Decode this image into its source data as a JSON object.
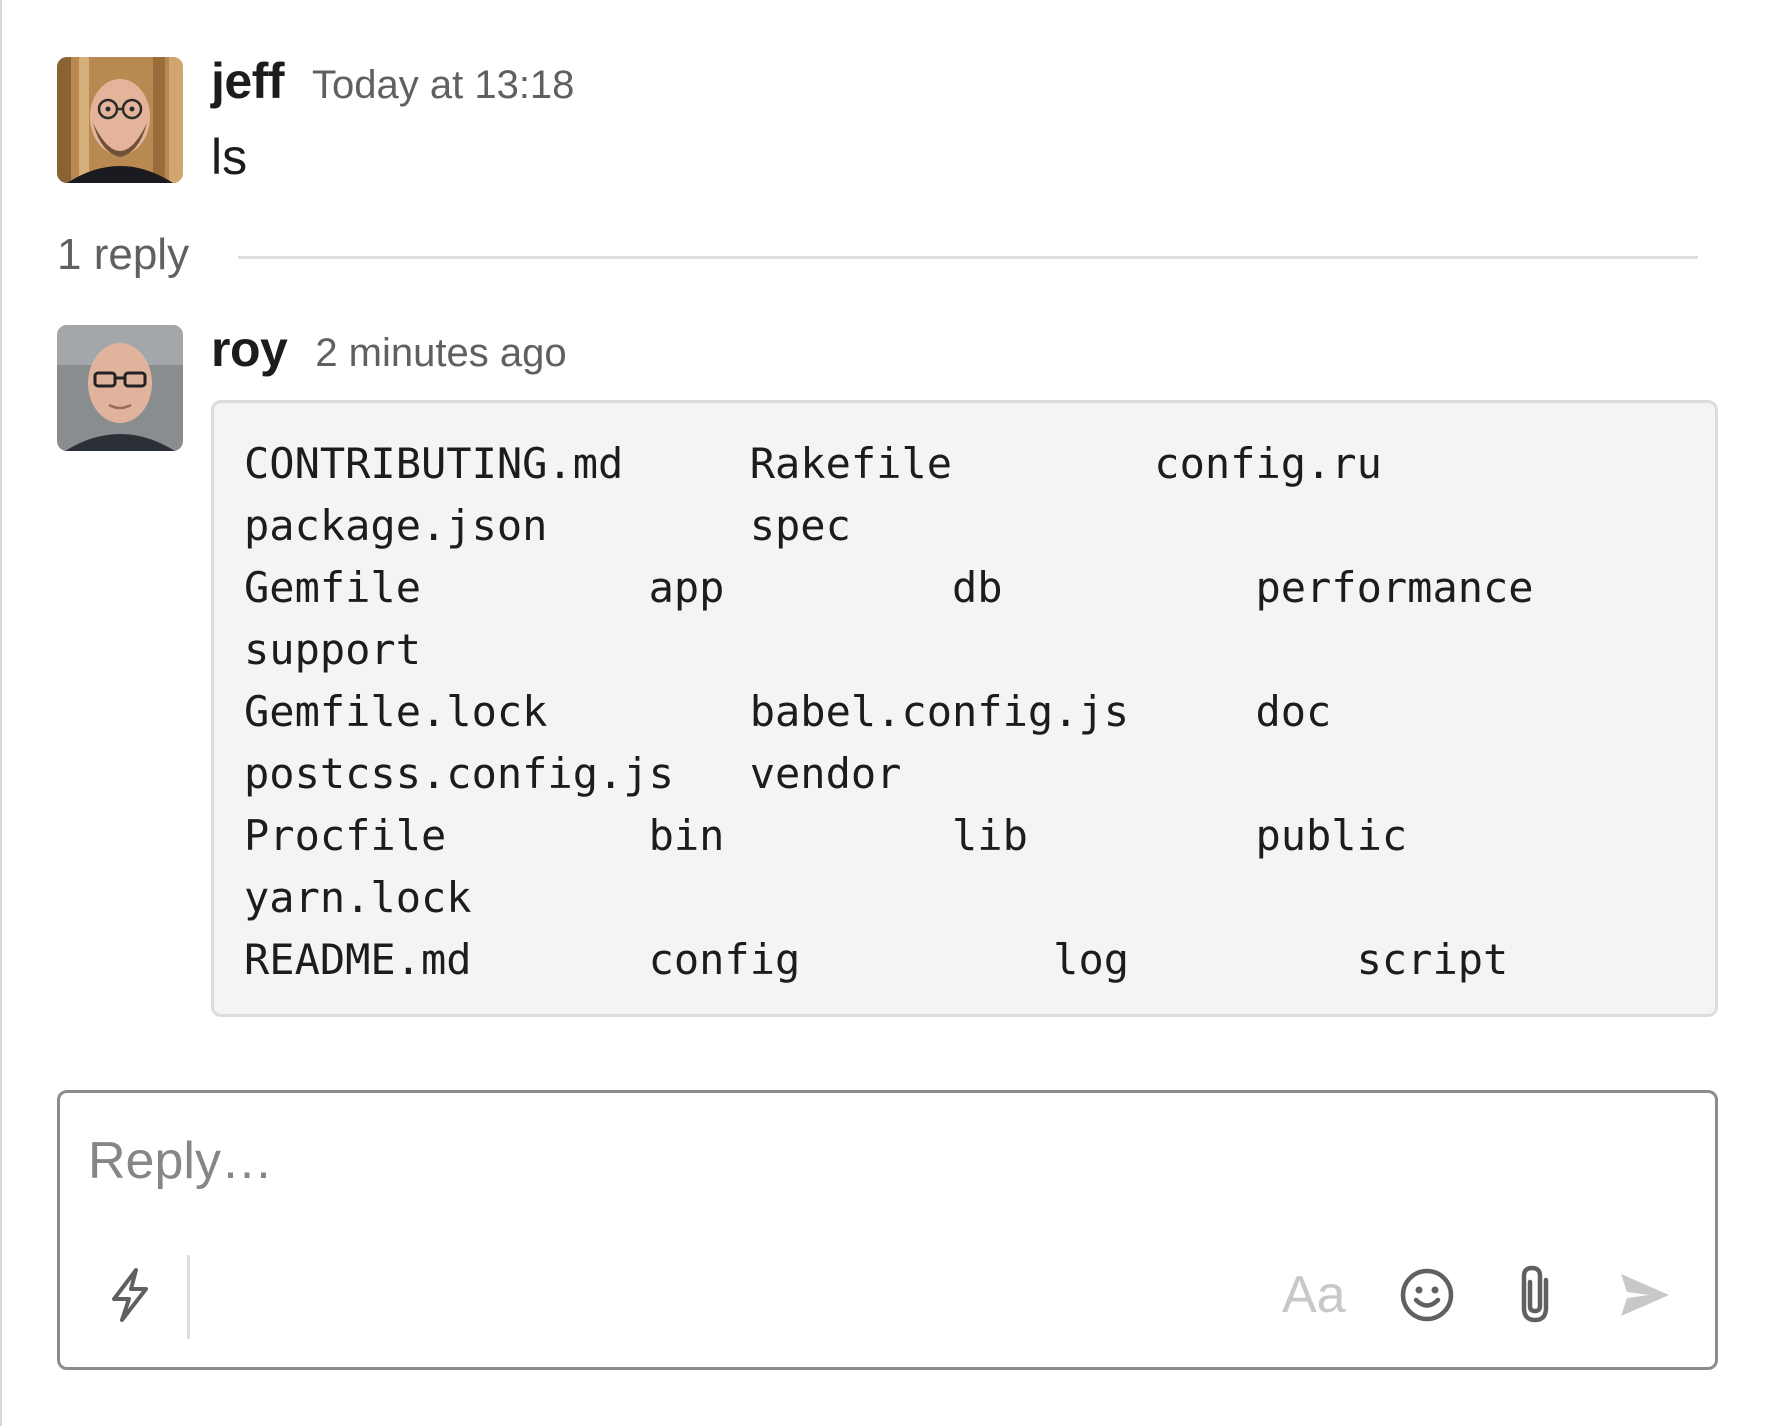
{
  "thread": {
    "parent": {
      "username": "jeff",
      "timestamp": "Today at 13:18",
      "text": "ls",
      "avatar": "avatar-jeff"
    },
    "reply_count_label": "1 reply",
    "replies": [
      {
        "username": "roy",
        "timestamp": "2 minutes ago",
        "avatar": "avatar-roy",
        "code_lines": [
          "CONTRIBUTING.md     Rakefile        config.ru",
          "package.json        spec",
          "Gemfile         app         db          performance",
          "support",
          "Gemfile.lock        babel.config.js     doc",
          "postcss.config.js   vendor",
          "Procfile        bin         lib         public",
          "yarn.lock",
          "README.md       config          log         script"
        ]
      }
    ]
  },
  "composer": {
    "placeholder": "Reply…",
    "format_label": "Aa",
    "icons": [
      "lightning-icon",
      "emoji-icon",
      "attachment-icon",
      "send-icon"
    ]
  },
  "colors": {
    "text": "#1d1c1d",
    "muted": "#616061",
    "code_background": "#f4f4f4",
    "code_border": "#dcdcdc",
    "composer_border": "#8c8c8c",
    "disabled_icon": "#c8c8c8"
  }
}
